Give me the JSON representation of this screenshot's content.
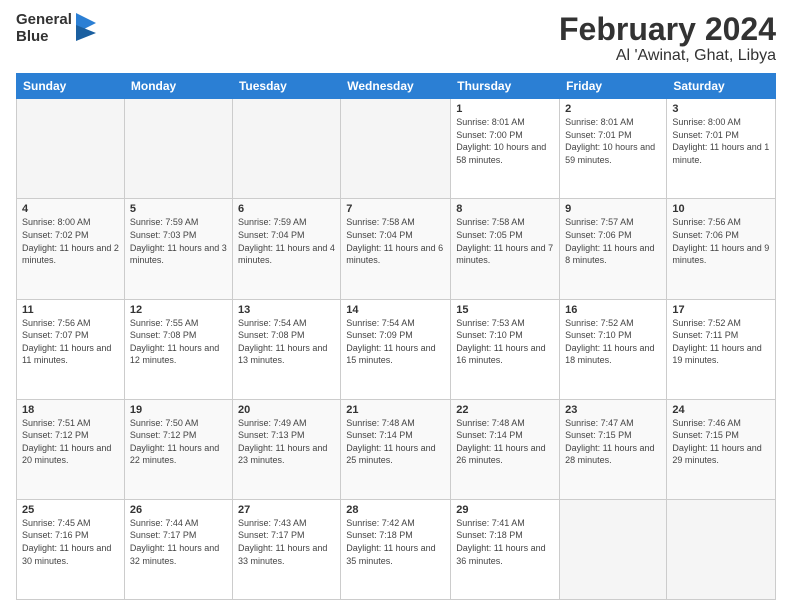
{
  "header": {
    "logo_line1": "General",
    "logo_line2": "Blue",
    "title": "February 2024",
    "subtitle": "Al 'Awinat, Ghat, Libya"
  },
  "weekdays": [
    "Sunday",
    "Monday",
    "Tuesday",
    "Wednesday",
    "Thursday",
    "Friday",
    "Saturday"
  ],
  "weeks": [
    [
      {
        "num": "",
        "info": ""
      },
      {
        "num": "",
        "info": ""
      },
      {
        "num": "",
        "info": ""
      },
      {
        "num": "",
        "info": ""
      },
      {
        "num": "1",
        "info": "Sunrise: 8:01 AM\nSunset: 7:00 PM\nDaylight: 10 hours and 58 minutes."
      },
      {
        "num": "2",
        "info": "Sunrise: 8:01 AM\nSunset: 7:01 PM\nDaylight: 10 hours and 59 minutes."
      },
      {
        "num": "3",
        "info": "Sunrise: 8:00 AM\nSunset: 7:01 PM\nDaylight: 11 hours and 1 minute."
      }
    ],
    [
      {
        "num": "4",
        "info": "Sunrise: 8:00 AM\nSunset: 7:02 PM\nDaylight: 11 hours and 2 minutes."
      },
      {
        "num": "5",
        "info": "Sunrise: 7:59 AM\nSunset: 7:03 PM\nDaylight: 11 hours and 3 minutes."
      },
      {
        "num": "6",
        "info": "Sunrise: 7:59 AM\nSunset: 7:04 PM\nDaylight: 11 hours and 4 minutes."
      },
      {
        "num": "7",
        "info": "Sunrise: 7:58 AM\nSunset: 7:04 PM\nDaylight: 11 hours and 6 minutes."
      },
      {
        "num": "8",
        "info": "Sunrise: 7:58 AM\nSunset: 7:05 PM\nDaylight: 11 hours and 7 minutes."
      },
      {
        "num": "9",
        "info": "Sunrise: 7:57 AM\nSunset: 7:06 PM\nDaylight: 11 hours and 8 minutes."
      },
      {
        "num": "10",
        "info": "Sunrise: 7:56 AM\nSunset: 7:06 PM\nDaylight: 11 hours and 9 minutes."
      }
    ],
    [
      {
        "num": "11",
        "info": "Sunrise: 7:56 AM\nSunset: 7:07 PM\nDaylight: 11 hours and 11 minutes."
      },
      {
        "num": "12",
        "info": "Sunrise: 7:55 AM\nSunset: 7:08 PM\nDaylight: 11 hours and 12 minutes."
      },
      {
        "num": "13",
        "info": "Sunrise: 7:54 AM\nSunset: 7:08 PM\nDaylight: 11 hours and 13 minutes."
      },
      {
        "num": "14",
        "info": "Sunrise: 7:54 AM\nSunset: 7:09 PM\nDaylight: 11 hours and 15 minutes."
      },
      {
        "num": "15",
        "info": "Sunrise: 7:53 AM\nSunset: 7:10 PM\nDaylight: 11 hours and 16 minutes."
      },
      {
        "num": "16",
        "info": "Sunrise: 7:52 AM\nSunset: 7:10 PM\nDaylight: 11 hours and 18 minutes."
      },
      {
        "num": "17",
        "info": "Sunrise: 7:52 AM\nSunset: 7:11 PM\nDaylight: 11 hours and 19 minutes."
      }
    ],
    [
      {
        "num": "18",
        "info": "Sunrise: 7:51 AM\nSunset: 7:12 PM\nDaylight: 11 hours and 20 minutes."
      },
      {
        "num": "19",
        "info": "Sunrise: 7:50 AM\nSunset: 7:12 PM\nDaylight: 11 hours and 22 minutes."
      },
      {
        "num": "20",
        "info": "Sunrise: 7:49 AM\nSunset: 7:13 PM\nDaylight: 11 hours and 23 minutes."
      },
      {
        "num": "21",
        "info": "Sunrise: 7:48 AM\nSunset: 7:14 PM\nDaylight: 11 hours and 25 minutes."
      },
      {
        "num": "22",
        "info": "Sunrise: 7:48 AM\nSunset: 7:14 PM\nDaylight: 11 hours and 26 minutes."
      },
      {
        "num": "23",
        "info": "Sunrise: 7:47 AM\nSunset: 7:15 PM\nDaylight: 11 hours and 28 minutes."
      },
      {
        "num": "24",
        "info": "Sunrise: 7:46 AM\nSunset: 7:15 PM\nDaylight: 11 hours and 29 minutes."
      }
    ],
    [
      {
        "num": "25",
        "info": "Sunrise: 7:45 AM\nSunset: 7:16 PM\nDaylight: 11 hours and 30 minutes."
      },
      {
        "num": "26",
        "info": "Sunrise: 7:44 AM\nSunset: 7:17 PM\nDaylight: 11 hours and 32 minutes."
      },
      {
        "num": "27",
        "info": "Sunrise: 7:43 AM\nSunset: 7:17 PM\nDaylight: 11 hours and 33 minutes."
      },
      {
        "num": "28",
        "info": "Sunrise: 7:42 AM\nSunset: 7:18 PM\nDaylight: 11 hours and 35 minutes."
      },
      {
        "num": "29",
        "info": "Sunrise: 7:41 AM\nSunset: 7:18 PM\nDaylight: 11 hours and 36 minutes."
      },
      {
        "num": "",
        "info": ""
      },
      {
        "num": "",
        "info": ""
      }
    ]
  ]
}
